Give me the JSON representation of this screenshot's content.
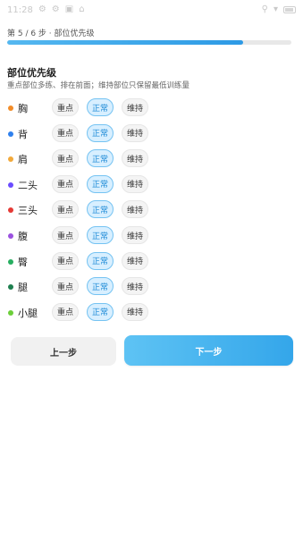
{
  "status_bar": {
    "time": "11:28",
    "left_icons": [
      "settings-icon",
      "settings-icon",
      "square-icon",
      "lock-icon"
    ],
    "right_icons": [
      "location-icon",
      "wifi-icon",
      "battery-icon"
    ]
  },
  "step": {
    "text": "第 5 / 6 步 · 部位优先级",
    "progress": 0.83
  },
  "section": {
    "title": "部位优先级",
    "subtitle": "重点部位多练、排在前面；维持部位只保留最低训练量"
  },
  "rows": [
    {
      "name": "胸",
      "dot_color": "#f28c28"
    },
    {
      "name": "背",
      "dot_color": "#2f80ed"
    },
    {
      "name": "肩",
      "dot_color": "#f2a93b"
    },
    {
      "name": "二头",
      "dot_color": "#6a4cff"
    },
    {
      "name": "三头",
      "dot_color": "#e53935"
    },
    {
      "name": "腹",
      "dot_color": "#9b51e0"
    },
    {
      "name": "臀",
      "dot_color": "#27ae60"
    },
    {
      "name": "腿",
      "dot_color": "#1e7f4f"
    },
    {
      "name": "小腿",
      "dot_color": "#6ccf3a"
    }
  ],
  "options": [
    "重点",
    "正常",
    "维持"
  ],
  "selected_option_index": 1,
  "buttons": {
    "prev": "上一步",
    "next": "下一步"
  }
}
